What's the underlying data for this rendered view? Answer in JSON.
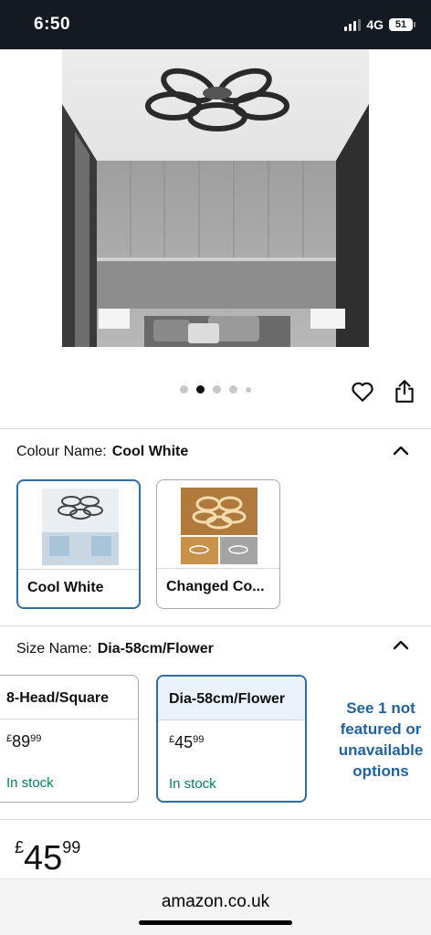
{
  "status_bar": {
    "time": "6:50",
    "network": "4G",
    "battery": "51"
  },
  "carousel": {
    "dot_count": 5,
    "active_index": 1
  },
  "colour": {
    "label": "Colour Name:",
    "value": "Cool White",
    "options": [
      {
        "label": "Cool White",
        "selected": true
      },
      {
        "label": "Changed Co...",
        "selected": false
      }
    ]
  },
  "size": {
    "label": "Size Name:",
    "value": "Dia-58cm/Flower",
    "options": [
      {
        "label": "8-Head/Square",
        "currency": "£",
        "price_whole": "89",
        "price_fraction": "99",
        "stock": "In stock",
        "selected": false
      },
      {
        "label": "Dia-58cm/Flower",
        "currency": "£",
        "price_whole": "45",
        "price_fraction": "99",
        "stock": "In stock",
        "selected": true
      }
    ],
    "see_more": "See 1 not featured or unavailable options"
  },
  "price": {
    "currency": "£",
    "whole": "45",
    "fraction": "99"
  },
  "url_bar": {
    "domain": "amazon.co.uk"
  },
  "icons": [
    "heart-icon",
    "share-icon",
    "chevron-up-icon"
  ],
  "colors": {
    "accent": "#2f6ea5",
    "link": "#2162a1",
    "in_stock": "#067d62",
    "status_bg": "#141a22"
  }
}
